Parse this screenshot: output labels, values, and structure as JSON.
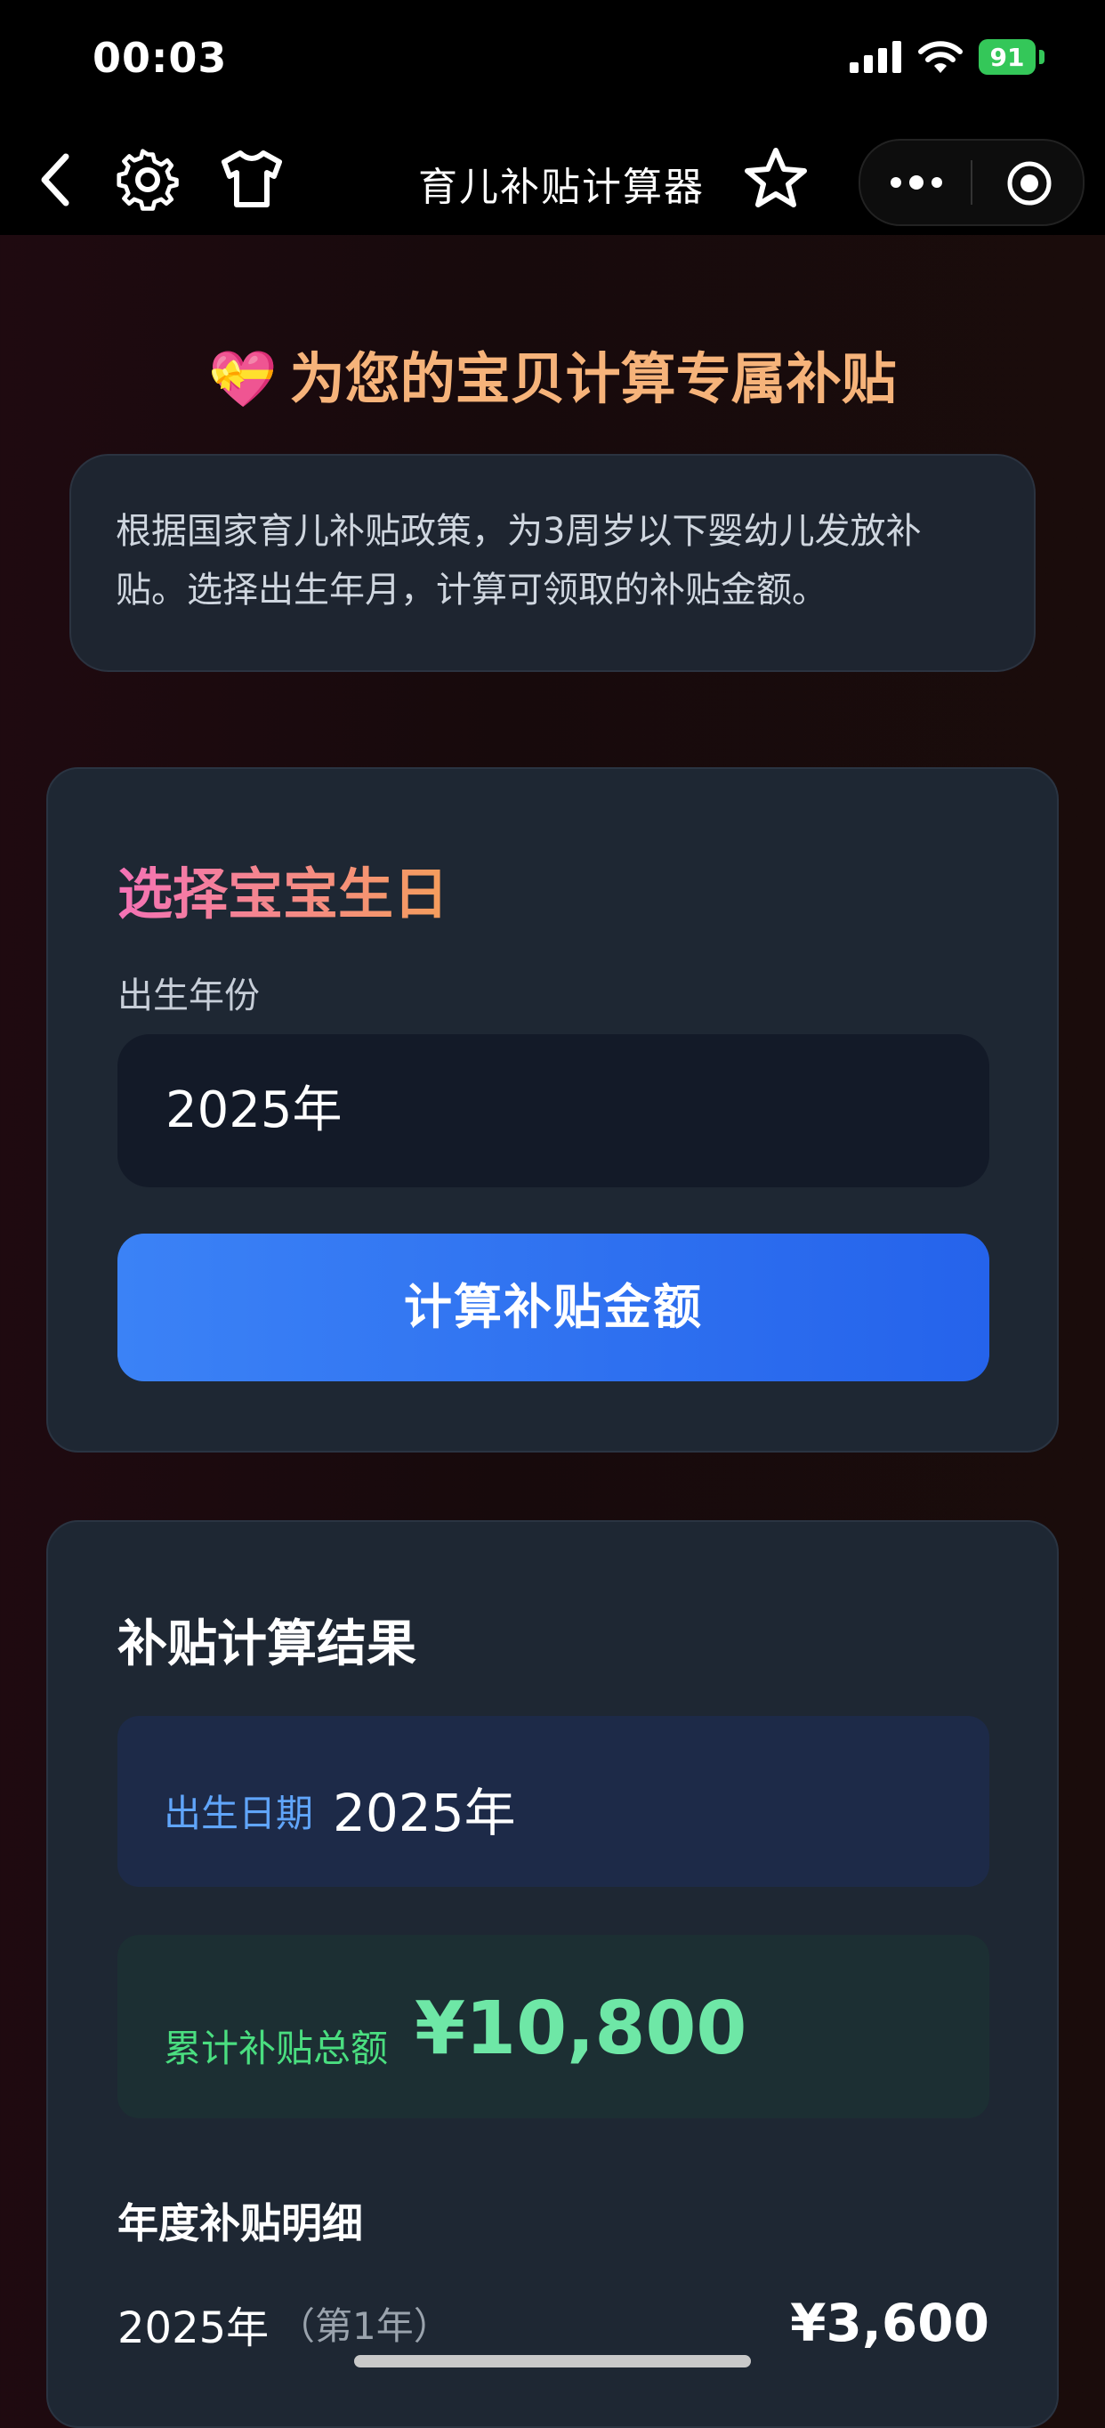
{
  "status_bar": {
    "time": "00:03",
    "battery": "91"
  },
  "nav": {
    "title": "育儿补贴计算器"
  },
  "hero": {
    "title": "为您的宝贝计算专属补贴"
  },
  "intro": {
    "text": "根据国家育儿补贴政策，为3周岁以下婴幼儿发放补贴。选择出生年月，计算可领取的补贴金额。"
  },
  "select_card": {
    "title": "选择宝宝生日",
    "year_label": "出生年份",
    "year_value": "2025年",
    "button": "计算补贴金额"
  },
  "result_card": {
    "title": "补贴计算结果",
    "birth_label": "出生日期",
    "birth_value": "2025年",
    "total_label": "累计补贴总额",
    "total_value": "¥10,800",
    "detail_title": "年度补贴明细",
    "rows": [
      {
        "year": "2025年",
        "sub": "（第1年）",
        "amount": "¥3,600"
      }
    ]
  },
  "colors": {
    "accent_blue": "#3b82f6",
    "green": "#4ade80",
    "orange": "#f6b37a"
  }
}
